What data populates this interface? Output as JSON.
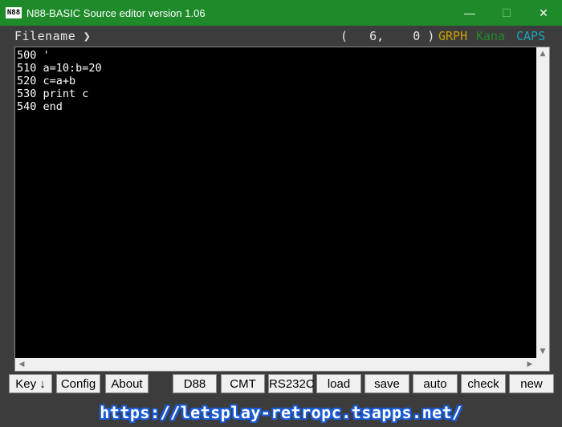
{
  "window": {
    "icon_text": "N88",
    "title": "N88-BASIC Source editor version 1.06",
    "minimize": "—",
    "maximize": "☐",
    "close": "✕"
  },
  "status": {
    "filename_label": "Filename ❯",
    "cursor_position": "(   6,    0 )",
    "modes": [
      {
        "label": "GRPH",
        "color": "#c8a000"
      },
      {
        "label": "Kana",
        "color": "#1f8a2a"
      },
      {
        "label": "CAPS",
        "color": "#1aa6b7"
      }
    ]
  },
  "editor": {
    "lines": [
      "500 '",
      "510 a=10:b=20",
      "520 c=a+b",
      "530 print c",
      "540 end"
    ]
  },
  "buttons": [
    {
      "id": "key",
      "label": "Key ↓"
    },
    {
      "id": "config",
      "label": "Config"
    },
    {
      "id": "about",
      "label": "About"
    },
    {
      "id": "d88",
      "label": "D88"
    },
    {
      "id": "cmt",
      "label": "CMT"
    },
    {
      "id": "rs232c",
      "label": "RS232C"
    },
    {
      "id": "load",
      "label": "load"
    },
    {
      "id": "save",
      "label": "save"
    },
    {
      "id": "auto",
      "label": "auto"
    },
    {
      "id": "check",
      "label": "check"
    },
    {
      "id": "new",
      "label": "new"
    }
  ],
  "footer": {
    "url": "https://letsplay-retropc.tsapps.net/"
  }
}
